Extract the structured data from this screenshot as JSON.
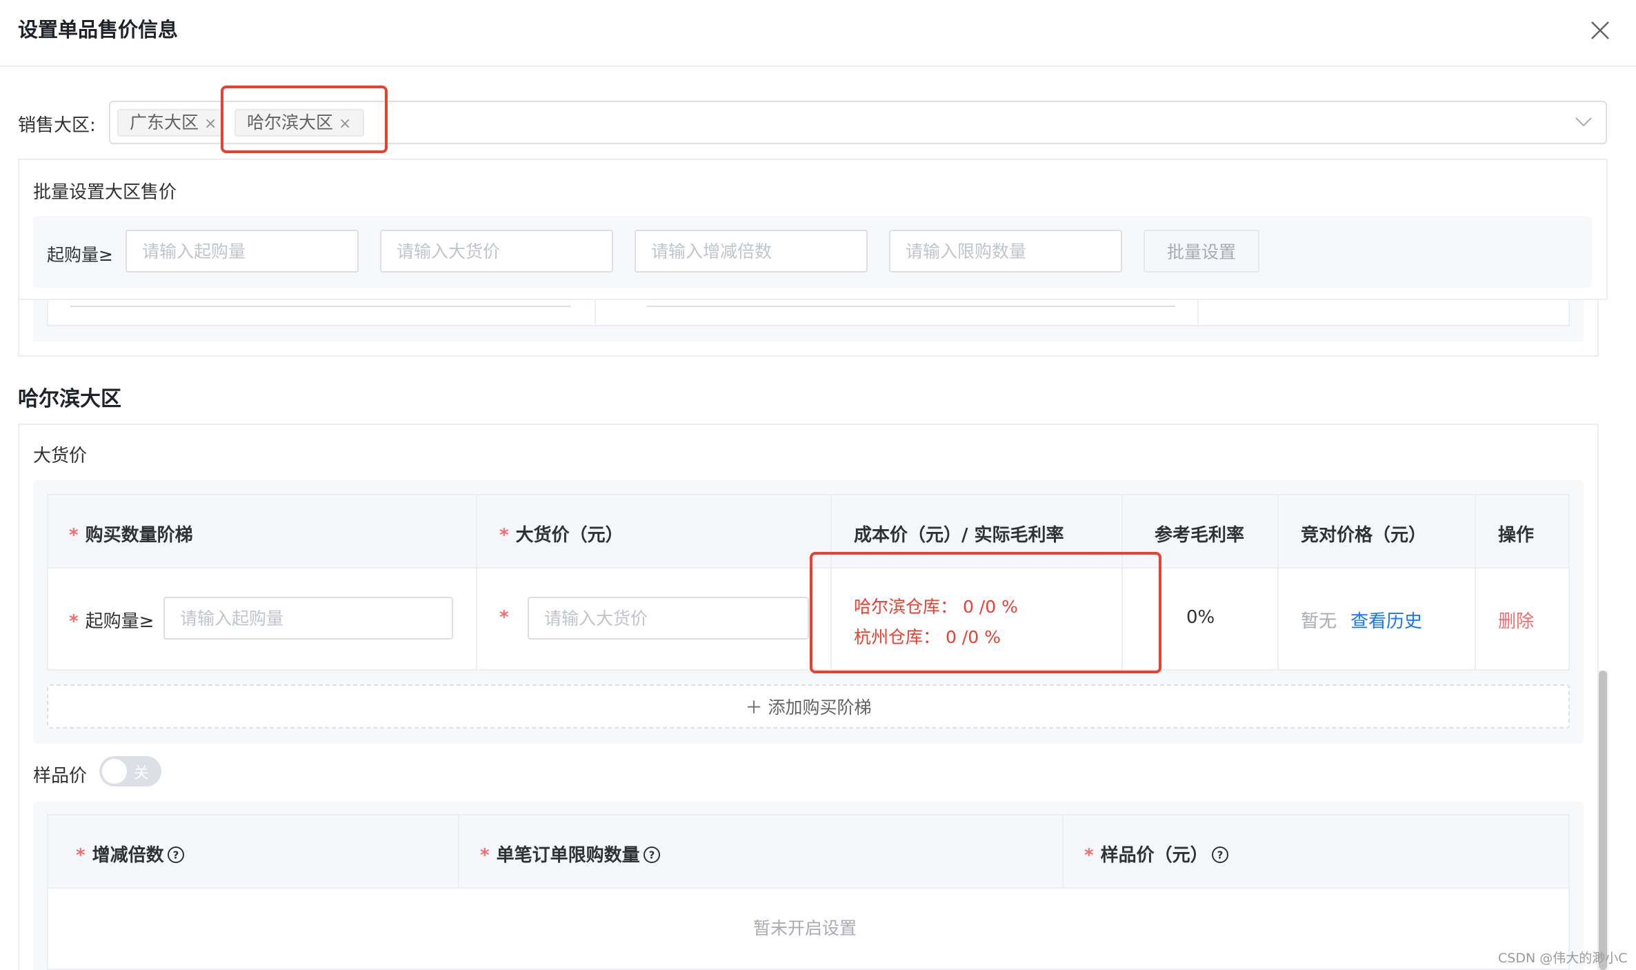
{
  "dialog": {
    "title": "设置单品售价信息",
    "close_icon": "close-icon"
  },
  "region_select": {
    "label": "销售大区:",
    "tags": [
      {
        "label": "广东大区",
        "close": "×"
      },
      {
        "label": "哈尔滨大区",
        "close": "×"
      }
    ],
    "arrow_icon": "chevron-down-icon"
  },
  "batch": {
    "title": "批量设置大区售价",
    "label": "起购量≥",
    "placeholders": {
      "min_qty": "请输入起购量",
      "bulk_price": "请输入大货价",
      "multiplier": "请输入增减倍数",
      "limit_qty": "请输入限购数量"
    },
    "button": "批量设置"
  },
  "section": {
    "title": "哈尔滨大区",
    "bulk_price_title": "大货价",
    "headers": {
      "tier": "购买数量阶梯",
      "bulk_price": "大货价（元）",
      "cost": "成本价（元）/ 实际毛利率",
      "ref_margin": "参考毛利率",
      "competitor": "竞对价格（元）",
      "action": "操作"
    },
    "required_mark": "*",
    "row": {
      "tier_label": "起购量≥",
      "tier_placeholder": "请输入起购量",
      "price_placeholder": "请输入大货价",
      "cost_lines": [
        "哈尔滨仓库： 0 /0 %",
        "杭州仓库： 0 /0 %"
      ],
      "ref_margin": "0%",
      "competitor_none": "暂无",
      "history_link": "查看历史",
      "delete": "删除"
    },
    "add_tier": "＋  添加购买阶梯"
  },
  "sample": {
    "label": "样品价",
    "switch_text": "关",
    "switch_on": false,
    "headers": {
      "multiplier": "增减倍数",
      "limit": "单笔订单限购数量",
      "sample_price": "样品价（元）"
    },
    "empty": "暂未开启设置"
  },
  "watermark": "CSDN @伟大的渺小C",
  "colors": {
    "highlight_box": "#e8412f",
    "link": "#1677ff",
    "danger": "#f56c6c"
  }
}
